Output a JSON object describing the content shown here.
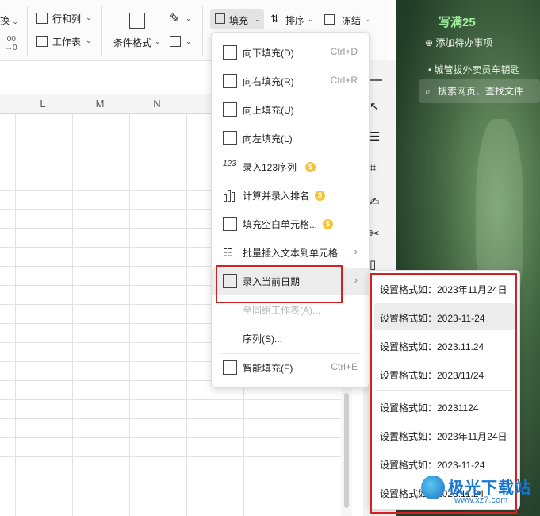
{
  "desktop_widget": {
    "title": "写满25",
    "add_todo": "添加待办事项",
    "item_1": "城管拔外卖员车钥匙",
    "search_placeholder": "搜索网页、查找文件"
  },
  "ribbon": {
    "cut_label": "换",
    "rows_cols_label": "行和列",
    "sheet_label": "工作表",
    "cond_format_label": "条件格式",
    "fill_label": "填充",
    "sort_label": "排序",
    "freeze_label": "冻结"
  },
  "sheet": {
    "columns": [
      "L",
      "M",
      "N"
    ]
  },
  "fill_menu": {
    "items": [
      {
        "label": "向下填充(D)",
        "shortcut": "Ctrl+D",
        "icon": "fill-down-icon"
      },
      {
        "label": "向右填充(R)",
        "shortcut": "Ctrl+R",
        "icon": "fill-right-icon"
      },
      {
        "label": "向上填充(U)",
        "shortcut": "",
        "icon": "fill-up-icon"
      },
      {
        "label": "向左填充(L)",
        "shortcut": "",
        "icon": "fill-left-icon"
      },
      {
        "label": "录入123序列",
        "icon": "sequence-123-icon",
        "premium": true
      },
      {
        "label": "计算并录入排名",
        "icon": "ranking-icon",
        "premium": true
      },
      {
        "label": "填充空白单元格...",
        "icon": "fill-blank-icon",
        "premium": true
      },
      {
        "label": "批量插入文本到单元格",
        "icon": "insert-text-icon",
        "has_submenu": true
      },
      {
        "label": "录入当前日期",
        "icon": "calendar-icon",
        "has_submenu": true,
        "active": true
      },
      {
        "label": "至同组工作表(A)...",
        "disabled": true
      },
      {
        "label": "序列(S)..."
      },
      {
        "label": "智能填充(F)",
        "shortcut": "Ctrl+E",
        "icon": "smart-fill-icon"
      }
    ],
    "coin_glyph": "$"
  },
  "date_submenu": {
    "items": [
      "设置格式如：2023年11月24日",
      "设置格式如：2023-11-24",
      "设置格式如：2023.11.24",
      "设置格式如：2023/11/24",
      "设置格式如：20231124",
      "设置格式如：2023年11月24日",
      "设置格式如：2023-11-24",
      "设置格式如：2023.11.24"
    ]
  },
  "watermark": {
    "name": "极光下载站",
    "url": "www.xz7.com"
  },
  "colors": {
    "highlight": "#d42020",
    "coin": "#f6c43a"
  }
}
